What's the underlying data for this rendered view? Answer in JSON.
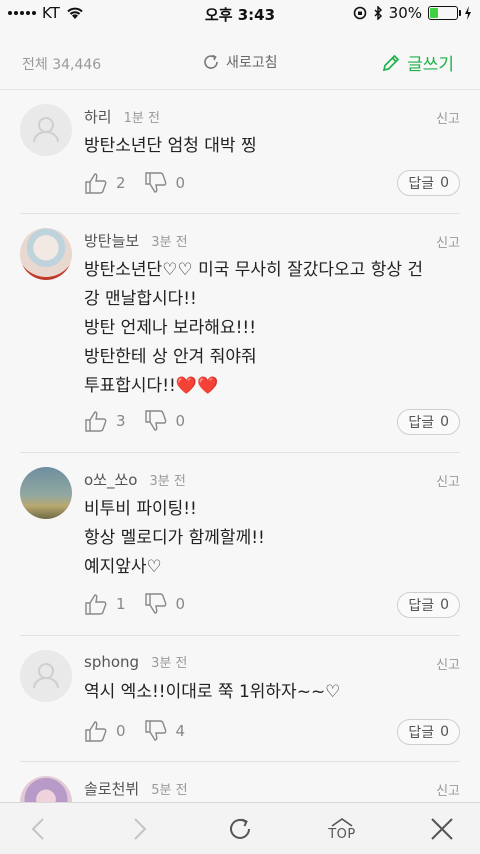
{
  "status_bar": {
    "carrier": "KT",
    "time": "오후 3:43",
    "battery": "30%",
    "battery_level": 0.3
  },
  "header": {
    "total": "전체 34,446",
    "refresh_label": "새로고침",
    "write_label": "글쓰기",
    "accent_color": "#1fb24a"
  },
  "comments": [
    {
      "nick": "하리",
      "time": "1분 전",
      "report": "신고",
      "text": "방탄소년단 엄청 대박 찡",
      "likes": "2",
      "dislikes": "0",
      "reply_label": "답글",
      "reply_count": "0",
      "avatar": "default"
    },
    {
      "nick": "방탄늘보",
      "time": "3분 전",
      "report": "신고",
      "text": "방탄소년단♡♡ 미국 무사히 잘갔다오고 항상 건\n강 맨날합시다!!\n방탄 언제나 보라해요!!!\n방탄한테 상 안겨 줘야줘\n투표합시다!!",
      "hearts": "❤️❤️",
      "likes": "3",
      "dislikes": "0",
      "reply_label": "답글",
      "reply_count": "0",
      "avatar": "photo"
    },
    {
      "nick": "o쏘_쏘o",
      "time": "3분 전",
      "report": "신고",
      "text": "비투비 파이팅!!\n항상 멜로디가 함께할께!!\n예지앞사♡",
      "likes": "1",
      "dislikes": "0",
      "reply_label": "답글",
      "reply_count": "0",
      "avatar": "photo"
    },
    {
      "nick": "sphong",
      "time": "3분 전",
      "report": "신고",
      "text": "역시 엑소!!이대로 쭉 1위하자~~♡",
      "likes": "0",
      "dislikes": "4",
      "reply_label": "답글",
      "reply_count": "0",
      "avatar": "default"
    },
    {
      "nick": "솔로천뷔",
      "time": "5분 전",
      "report": "신고",
      "text": "",
      "avatar": "photo"
    }
  ],
  "bottom_bar": {
    "top_label": "TOP"
  }
}
